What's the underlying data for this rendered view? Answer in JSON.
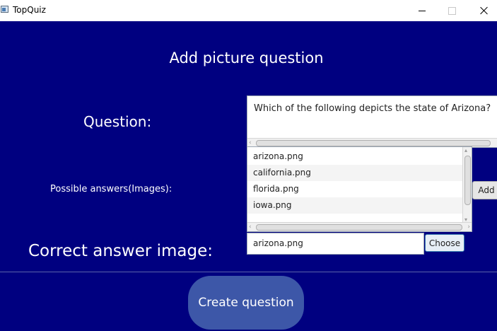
{
  "window": {
    "title": "TopQuiz",
    "icon": "app-window-icon",
    "controls": [
      "minimize-icon",
      "maximize-icon",
      "close-icon"
    ]
  },
  "page": {
    "heading": "Add picture question",
    "question_label": "Question:",
    "answers_label": "Possible answers(Images):",
    "correct_label": "Correct answer image:"
  },
  "question": {
    "value": "Which of the following depicts the state of Arizona?"
  },
  "answers": {
    "items": [
      "arizona.png",
      "california.png",
      "florida.png",
      "iowa.png"
    ]
  },
  "correct_answer": {
    "value": "arizona.png"
  },
  "buttons": {
    "add": "Add",
    "choose": "Choose",
    "create": "Create question"
  },
  "colors": {
    "background": "#000080",
    "create_button": "#3d57a8",
    "text": "#ffffff"
  }
}
